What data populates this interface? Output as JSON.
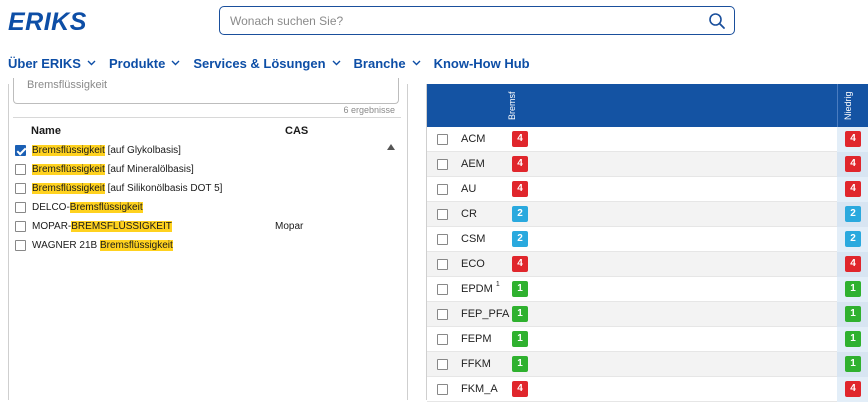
{
  "header": {
    "logo_text": "ERIKS",
    "search_placeholder": "Wonach suchen Sie?"
  },
  "nav": {
    "items": [
      {
        "label": "Über ERIKS",
        "has_dropdown": true
      },
      {
        "label": "Produkte",
        "has_dropdown": true
      },
      {
        "label": "Services & Lösungen",
        "has_dropdown": true
      },
      {
        "label": "Branche",
        "has_dropdown": true
      },
      {
        "label": "Know-How Hub",
        "has_dropdown": false
      }
    ]
  },
  "filter": {
    "value": "Bremsflüssigkeit",
    "result_count": "6 ergebnisse",
    "columns": {
      "name": "Name",
      "cas": "CAS"
    },
    "items": [
      {
        "pre": "",
        "hl": "Bremsflüssigkeit",
        "post": " [auf Glykolbasis]",
        "cas": "",
        "checked": true
      },
      {
        "pre": "",
        "hl": "Bremsflüssigkeit",
        "post": " [auf Mineralölbasis]",
        "cas": "",
        "checked": false
      },
      {
        "pre": "",
        "hl": "Bremsflüssigkeit",
        "post": " [auf Silikonölbasis DOT 5]",
        "cas": "",
        "checked": false
      },
      {
        "pre": "DELCO-",
        "hl": "Bremsflüssigkeit",
        "post": "",
        "cas": "",
        "checked": false
      },
      {
        "pre": "MOPAR-",
        "hl": "BREMSFLÜSSIGKEIT",
        "post": "",
        "cas": "Mopar",
        "checked": false
      },
      {
        "pre": "WAGNER 21B ",
        "hl": "Bremsflüssigkeit",
        "post": "",
        "cas": "",
        "checked": false
      }
    ]
  },
  "compat": {
    "columns": [
      "Bremsf",
      "Niedrig"
    ],
    "colors": {
      "1": "#2fb12f",
      "2": "#2aa9de",
      "4": "#e0262c"
    },
    "rows": [
      {
        "name": "ACM",
        "sup": "",
        "values": [
          "4",
          "4"
        ]
      },
      {
        "name": "AEM",
        "sup": "",
        "values": [
          "4",
          "4"
        ]
      },
      {
        "name": "AU",
        "sup": "",
        "values": [
          "4",
          "4"
        ]
      },
      {
        "name": "CR",
        "sup": "",
        "values": [
          "2",
          "2"
        ]
      },
      {
        "name": "CSM",
        "sup": "",
        "values": [
          "2",
          "2"
        ]
      },
      {
        "name": "ECO",
        "sup": "",
        "values": [
          "4",
          "4"
        ]
      },
      {
        "name": "EPDM",
        "sup": "1",
        "values": [
          "1",
          "1"
        ]
      },
      {
        "name": "FEP_PFA",
        "sup": "",
        "values": [
          "1",
          "1"
        ]
      },
      {
        "name": "FEPM",
        "sup": "",
        "values": [
          "1",
          "1"
        ]
      },
      {
        "name": "FFKM",
        "sup": "",
        "values": [
          "1",
          "1"
        ]
      },
      {
        "name": "FKM_A",
        "sup": "",
        "values": [
          "4",
          "4"
        ]
      }
    ]
  }
}
